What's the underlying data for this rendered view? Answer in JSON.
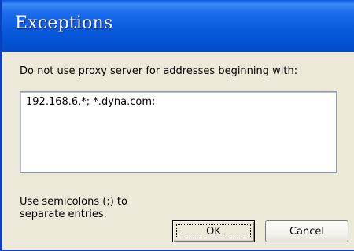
{
  "dialog": {
    "title": "Exceptions",
    "prompt": "Do not use proxy server for addresses beginning with:",
    "entries_value": "192.168.6.*; *.dyna.com;",
    "hint_line1": "Use semicolons (;) to",
    "hint_line2": "separate entries.",
    "ok_label": "OK",
    "cancel_label": "Cancel"
  },
  "colors": {
    "titlebar": "#0a58e8",
    "dialog_background": "#ece9d8",
    "input_border": "#7f9db9"
  }
}
